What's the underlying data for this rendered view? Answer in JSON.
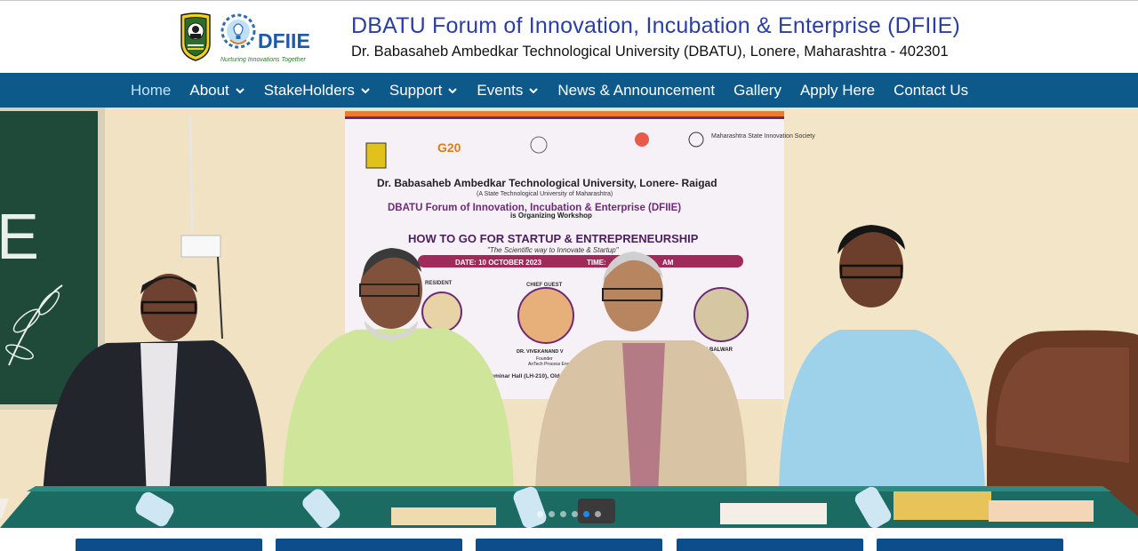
{
  "header": {
    "title": "DBATU Forum of Innovation, Incubation & Enterprise (DFIIE)",
    "subtitle": "Dr. Babasaheb Ambedkar Technological University (DBATU), Lonere, Maharashtra - 402301",
    "logo_text": "DFIIE",
    "logo_tagline": "Nurturing Innovations Together"
  },
  "nav": {
    "items": [
      {
        "label": "Home",
        "dropdown": false,
        "active": true
      },
      {
        "label": "About",
        "dropdown": true
      },
      {
        "label": "StakeHolders",
        "dropdown": true
      },
      {
        "label": "Support",
        "dropdown": true
      },
      {
        "label": "Events",
        "dropdown": true
      },
      {
        "label": "News & Announcement",
        "dropdown": false
      },
      {
        "label": "Gallery",
        "dropdown": false
      },
      {
        "label": "Apply Here",
        "dropdown": false
      },
      {
        "label": "Contact Us",
        "dropdown": false
      }
    ]
  },
  "hero": {
    "banner_univ": "Dr. Babasaheb Ambedkar Technological University, Lonere- Raigad",
    "banner_state": "(A State Technological University of Maharashtra)",
    "banner_forum": "DBATU Forum of Innovation, Incubation & Enterprise (DFIIE)",
    "banner_org": "is Organizing Workshop",
    "banner_heading": "HOW TO GO FOR STARTUP & ENTREPRENEURSHIP",
    "banner_tagline": "\"The Scientific way to Innovate & Startup\"",
    "banner_date": "DATE: 10 OCTOBER 2023",
    "banner_time": "TIME:",
    "banner_time_val": "AM",
    "banner_guest_role": "CHIEF GUEST",
    "banner_guest_name": "DR. VIVEKANAND V",
    "banner_guest_title": "Founder",
    "banner_guest_org": "AnTech Process Eng.",
    "banner_president": "RESIDENT",
    "banner_other": "ALBALWAR",
    "banner_venue": "Seminar Hall (LH-210), Old Building, DBATU, Lonere",
    "banner_g20": "G20",
    "banner_msins": "Maharashtra State Innovation Society",
    "slides": 6,
    "active_slide": 4,
    "colors": {
      "nav": "#0d5a8a",
      "title": "#2b3fa0",
      "dot_active": "#1e88e5"
    }
  }
}
